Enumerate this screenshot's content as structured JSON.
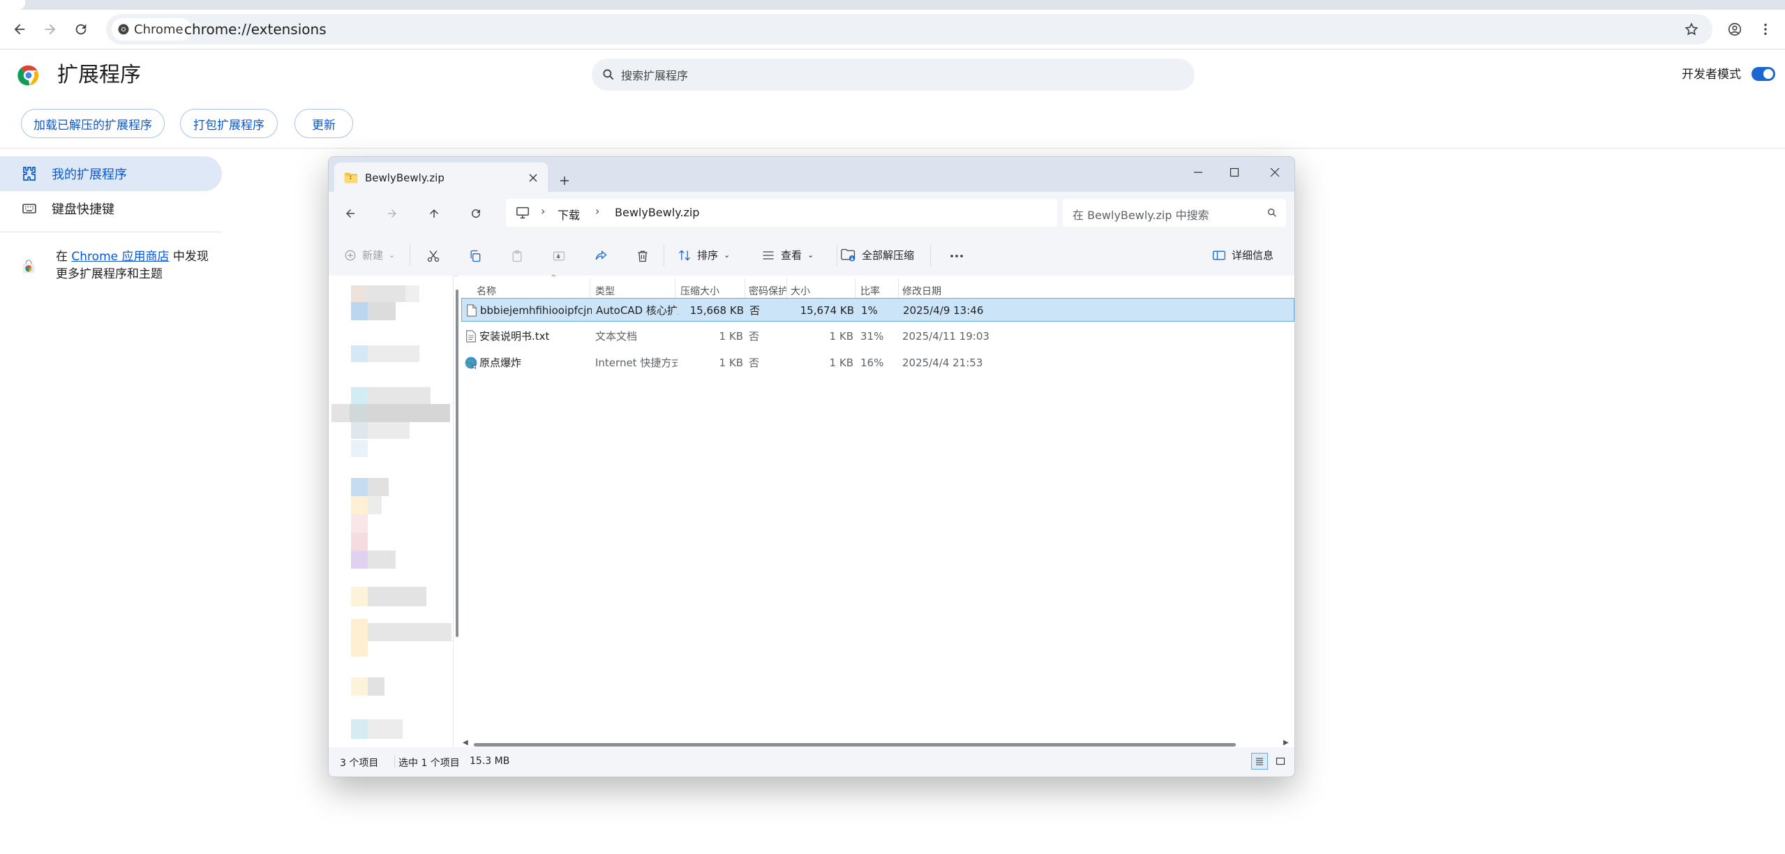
{
  "browser": {
    "chip_label": "Chrome",
    "url": "chrome://extensions"
  },
  "extensions_page": {
    "title": "扩展程序",
    "search_placeholder": "搜索扩展程序",
    "dev_mode_label": "开发者模式",
    "dev_mode_on": true,
    "buttons": {
      "load_unpacked": "加载已解压的扩展程序",
      "pack": "打包扩展程序",
      "update": "更新"
    },
    "nav": {
      "my_extensions": "我的扩展程序",
      "shortcuts": "键盘快捷键"
    },
    "store": {
      "prefix": "在",
      "link": "Chrome 应用商店",
      "suffix": "中发现更多扩展程序和主题"
    }
  },
  "explorer": {
    "tab_title": "BewlyBewly.zip",
    "breadcrumb": [
      "下载",
      "BewlyBewly.zip"
    ],
    "search_placeholder": "在 BewlyBewly.zip 中搜索",
    "commands": {
      "new": "新建",
      "sort": "排序",
      "view": "查看",
      "extract_all": "全部解压缩",
      "details": "详细信息"
    },
    "columns": {
      "name": "名称",
      "type": "类型",
      "compressed": "压缩大小",
      "password": "密码保护",
      "size": "大小",
      "ratio": "比率",
      "modified": "修改日期"
    },
    "files": [
      {
        "name": "bbbiejemhfihiooipfcjmjmbfdm...",
        "type": "AutoCAD 核心扩展",
        "compressed": "15,668 KB",
        "password": "否",
        "size": "15,674 KB",
        "ratio": "1%",
        "modified": "2025/4/9 13:46",
        "icon": "file-icon",
        "selected": true
      },
      {
        "name": "安装说明书.txt",
        "type": "文本文档",
        "compressed": "1 KB",
        "password": "否",
        "size": "1 KB",
        "ratio": "31%",
        "modified": "2025/4/11 19:03",
        "icon": "text-file-icon",
        "selected": false
      },
      {
        "name": "原点爆炸",
        "type": "Internet 快捷方式",
        "compressed": "1 KB",
        "password": "否",
        "size": "1 KB",
        "ratio": "16%",
        "modified": "2025/4/4 21:53",
        "icon": "globe-icon",
        "selected": false
      }
    ],
    "status": {
      "count": "3 个项目",
      "selected": "选中 1 个项目",
      "size": "15.3 MB"
    }
  }
}
